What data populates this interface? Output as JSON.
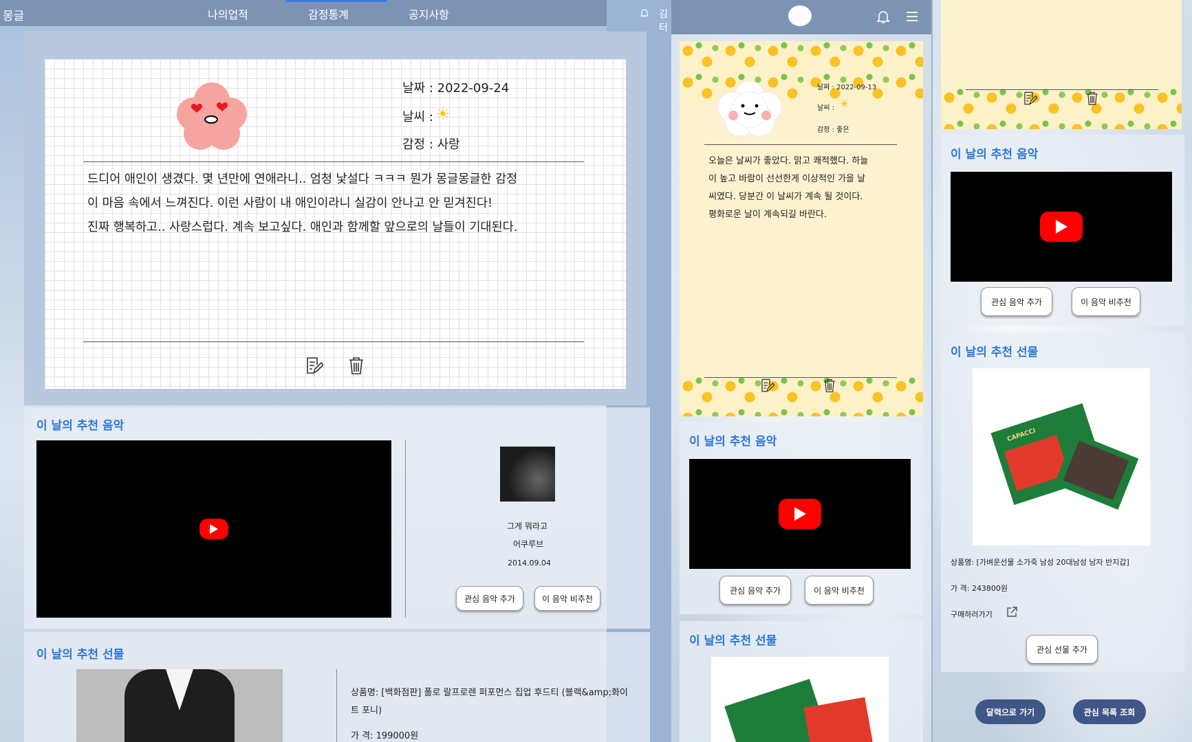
{
  "left_panel": {
    "header": {
      "logo_text": "몽글",
      "nav": [
        "나의업적",
        "감정통계",
        "공지사항"
      ],
      "user_text": "김터"
    },
    "diary": {
      "date_label": "날짜 : 2022-09-24",
      "weather_label": "날씨 :",
      "emotion_label": "감정 : 사랑",
      "lines": [
        "드디어 애인이 생겼다. 몇 년만에 연애라니.. 엄청 낯설다 ㅋㅋㅋ 뭔가 몽글몽글한 감정",
        "이 마음 속에서 느껴진다. 이런 사람이 내 애인이라니 실감이 안나고 안 믿겨진다!",
        "진짜 행복하고.. 사랑스럽다. 계속 보고싶다. 애인과 함께할 앞으로의 날들이 기대된다."
      ]
    },
    "music": {
      "title": "이 날의 추천 음악",
      "song": "그게 뭐라고",
      "artist": "어쿠루브",
      "date": "2014.09.04",
      "add_btn": "관심 음악 추가",
      "dislike_btn": "이 음악 비추천"
    },
    "gift": {
      "title": "이 날의 추천 선물",
      "name": "상품명: [백화점판] 폴로 랄프로렌 퍼포먼스 집업 후드티 (블랙&amp;화이트 포니)",
      "price": "가 격: 199000원"
    }
  },
  "mid_panel": {
    "diary": {
      "date_label": "날짜 : 2022-09-13",
      "weather_label": "날씨 :",
      "emotion_label": "감정 : 좋은",
      "lines": [
        "오늘은 날씨가 좋았다. 맑고 쾌적했다. 하늘",
        "이 높고 바람이 선선한게 이상적인 가을 날",
        "씨였다. 당분간 이 날씨가 계속 될 것이다.",
        "평화로운 날이 계속되길 바란다."
      ]
    },
    "music": {
      "title": "이 날의 추천 음악",
      "add_btn": "관심 음악 추가",
      "dislike_btn": "이 음악 비추천"
    },
    "gift": {
      "title": "이 날의 추천 선물"
    }
  },
  "right_panel": {
    "music": {
      "title": "이 날의 추천 음악",
      "add_btn": "관심 음악 추가",
      "dislike_btn": "이 음악 비추천"
    },
    "gift": {
      "title": "이 날의 추천 선물",
      "name": "상품명: [가벼운선물 소가죽 남성 20대남성 남자 반지갑]",
      "price": "가 격: 243800원",
      "buy_link": "구매하러가기",
      "add_btn": "관심 선물 추가",
      "brand": "CAPACCI"
    },
    "footer": {
      "calendar_btn": "달력으로 가기",
      "wishlist_btn": "관심 목록 조회"
    }
  },
  "colors": {
    "accent": "#2a77d6",
    "navbar": "#7d93b4",
    "pill": "#3f5686",
    "youtube": "#ff0000"
  }
}
